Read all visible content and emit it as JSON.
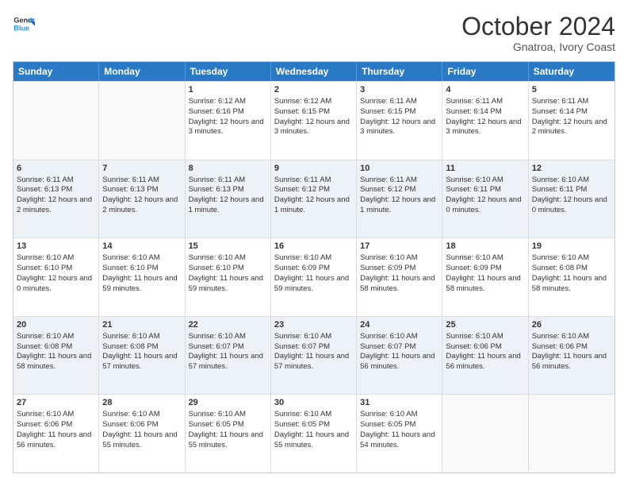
{
  "header": {
    "logo_general": "General",
    "logo_blue": "Blue",
    "month_title": "October 2024",
    "subtitle": "Gnatroa, Ivory Coast"
  },
  "weekdays": [
    "Sunday",
    "Monday",
    "Tuesday",
    "Wednesday",
    "Thursday",
    "Friday",
    "Saturday"
  ],
  "rows": [
    [
      {
        "day": "",
        "sunrise": "",
        "sunset": "",
        "daylight": ""
      },
      {
        "day": "",
        "sunrise": "",
        "sunset": "",
        "daylight": ""
      },
      {
        "day": "1",
        "sunrise": "Sunrise: 6:12 AM",
        "sunset": "Sunset: 6:16 PM",
        "daylight": "Daylight: 12 hours and 3 minutes."
      },
      {
        "day": "2",
        "sunrise": "Sunrise: 6:12 AM",
        "sunset": "Sunset: 6:15 PM",
        "daylight": "Daylight: 12 hours and 3 minutes."
      },
      {
        "day": "3",
        "sunrise": "Sunrise: 6:11 AM",
        "sunset": "Sunset: 6:15 PM",
        "daylight": "Daylight: 12 hours and 3 minutes."
      },
      {
        "day": "4",
        "sunrise": "Sunrise: 6:11 AM",
        "sunset": "Sunset: 6:14 PM",
        "daylight": "Daylight: 12 hours and 3 minutes."
      },
      {
        "day": "5",
        "sunrise": "Sunrise: 6:11 AM",
        "sunset": "Sunset: 6:14 PM",
        "daylight": "Daylight: 12 hours and 2 minutes."
      }
    ],
    [
      {
        "day": "6",
        "sunrise": "Sunrise: 6:11 AM",
        "sunset": "Sunset: 6:13 PM",
        "daylight": "Daylight: 12 hours and 2 minutes."
      },
      {
        "day": "7",
        "sunrise": "Sunrise: 6:11 AM",
        "sunset": "Sunset: 6:13 PM",
        "daylight": "Daylight: 12 hours and 2 minutes."
      },
      {
        "day": "8",
        "sunrise": "Sunrise: 6:11 AM",
        "sunset": "Sunset: 6:13 PM",
        "daylight": "Daylight: 12 hours and 1 minute."
      },
      {
        "day": "9",
        "sunrise": "Sunrise: 6:11 AM",
        "sunset": "Sunset: 6:12 PM",
        "daylight": "Daylight: 12 hours and 1 minute."
      },
      {
        "day": "10",
        "sunrise": "Sunrise: 6:11 AM",
        "sunset": "Sunset: 6:12 PM",
        "daylight": "Daylight: 12 hours and 1 minute."
      },
      {
        "day": "11",
        "sunrise": "Sunrise: 6:10 AM",
        "sunset": "Sunset: 6:11 PM",
        "daylight": "Daylight: 12 hours and 0 minutes."
      },
      {
        "day": "12",
        "sunrise": "Sunrise: 6:10 AM",
        "sunset": "Sunset: 6:11 PM",
        "daylight": "Daylight: 12 hours and 0 minutes."
      }
    ],
    [
      {
        "day": "13",
        "sunrise": "Sunrise: 6:10 AM",
        "sunset": "Sunset: 6:10 PM",
        "daylight": "Daylight: 12 hours and 0 minutes."
      },
      {
        "day": "14",
        "sunrise": "Sunrise: 6:10 AM",
        "sunset": "Sunset: 6:10 PM",
        "daylight": "Daylight: 11 hours and 59 minutes."
      },
      {
        "day": "15",
        "sunrise": "Sunrise: 6:10 AM",
        "sunset": "Sunset: 6:10 PM",
        "daylight": "Daylight: 11 hours and 59 minutes."
      },
      {
        "day": "16",
        "sunrise": "Sunrise: 6:10 AM",
        "sunset": "Sunset: 6:09 PM",
        "daylight": "Daylight: 11 hours and 59 minutes."
      },
      {
        "day": "17",
        "sunrise": "Sunrise: 6:10 AM",
        "sunset": "Sunset: 6:09 PM",
        "daylight": "Daylight: 11 hours and 58 minutes."
      },
      {
        "day": "18",
        "sunrise": "Sunrise: 6:10 AM",
        "sunset": "Sunset: 6:09 PM",
        "daylight": "Daylight: 11 hours and 58 minutes."
      },
      {
        "day": "19",
        "sunrise": "Sunrise: 6:10 AM",
        "sunset": "Sunset: 6:08 PM",
        "daylight": "Daylight: 11 hours and 58 minutes."
      }
    ],
    [
      {
        "day": "20",
        "sunrise": "Sunrise: 6:10 AM",
        "sunset": "Sunset: 6:08 PM",
        "daylight": "Daylight: 11 hours and 58 minutes."
      },
      {
        "day": "21",
        "sunrise": "Sunrise: 6:10 AM",
        "sunset": "Sunset: 6:08 PM",
        "daylight": "Daylight: 11 hours and 57 minutes."
      },
      {
        "day": "22",
        "sunrise": "Sunrise: 6:10 AM",
        "sunset": "Sunset: 6:07 PM",
        "daylight": "Daylight: 11 hours and 57 minutes."
      },
      {
        "day": "23",
        "sunrise": "Sunrise: 6:10 AM",
        "sunset": "Sunset: 6:07 PM",
        "daylight": "Daylight: 11 hours and 57 minutes."
      },
      {
        "day": "24",
        "sunrise": "Sunrise: 6:10 AM",
        "sunset": "Sunset: 6:07 PM",
        "daylight": "Daylight: 11 hours and 56 minutes."
      },
      {
        "day": "25",
        "sunrise": "Sunrise: 6:10 AM",
        "sunset": "Sunset: 6:06 PM",
        "daylight": "Daylight: 11 hours and 56 minutes."
      },
      {
        "day": "26",
        "sunrise": "Sunrise: 6:10 AM",
        "sunset": "Sunset: 6:06 PM",
        "daylight": "Daylight: 11 hours and 56 minutes."
      }
    ],
    [
      {
        "day": "27",
        "sunrise": "Sunrise: 6:10 AM",
        "sunset": "Sunset: 6:06 PM",
        "daylight": "Daylight: 11 hours and 56 minutes."
      },
      {
        "day": "28",
        "sunrise": "Sunrise: 6:10 AM",
        "sunset": "Sunset: 6:06 PM",
        "daylight": "Daylight: 11 hours and 55 minutes."
      },
      {
        "day": "29",
        "sunrise": "Sunrise: 6:10 AM",
        "sunset": "Sunset: 6:05 PM",
        "daylight": "Daylight: 11 hours and 55 minutes."
      },
      {
        "day": "30",
        "sunrise": "Sunrise: 6:10 AM",
        "sunset": "Sunset: 6:05 PM",
        "daylight": "Daylight: 11 hours and 55 minutes."
      },
      {
        "day": "31",
        "sunrise": "Sunrise: 6:10 AM",
        "sunset": "Sunset: 6:05 PM",
        "daylight": "Daylight: 11 hours and 54 minutes."
      },
      {
        "day": "",
        "sunrise": "",
        "sunset": "",
        "daylight": ""
      },
      {
        "day": "",
        "sunrise": "",
        "sunset": "",
        "daylight": ""
      }
    ]
  ]
}
